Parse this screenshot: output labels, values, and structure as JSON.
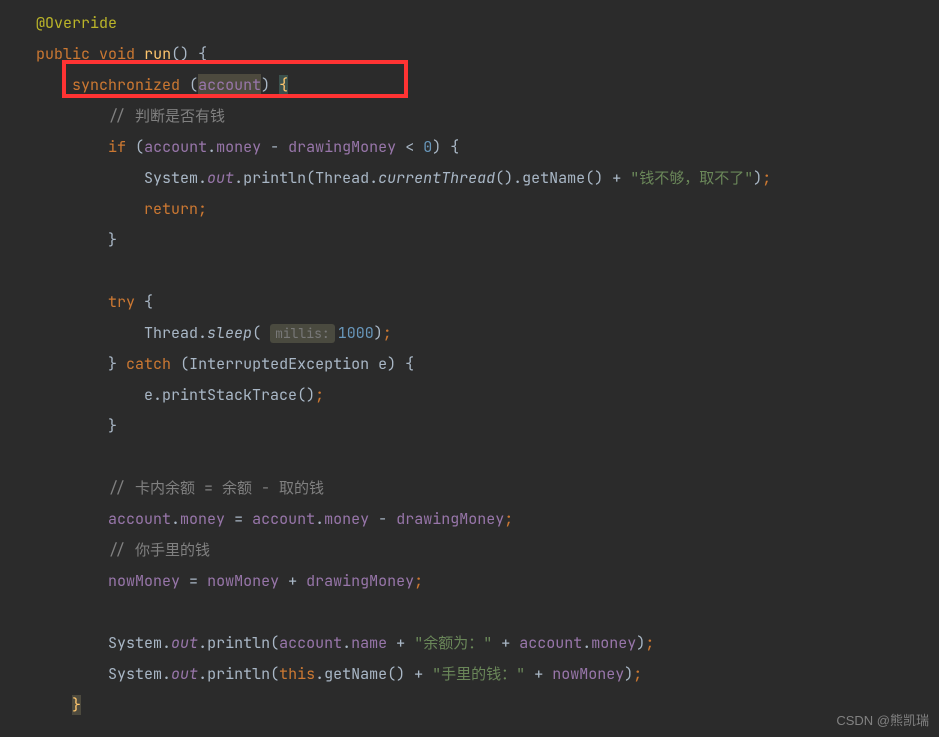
{
  "code": {
    "l1_annotation": "@Override",
    "l2_kw1": "public",
    "l2_kw2": "void",
    "l2_method": "run",
    "l3_kw": "synchronized",
    "l3_var": "account",
    "l4_comment": "// 判断是否有钱",
    "l5_kw": "if",
    "l5_acc": "account",
    "l5_money": "money",
    "l5_draw": "drawingMoney",
    "l5_zero": "0",
    "l6_sys": "System",
    "l6_out": "out",
    "l6_println": "println",
    "l6_thread": "Thread",
    "l6_ct": "currentThread",
    "l6_getName": "getName",
    "l6_str": "\"钱不够，取不了\"",
    "l7_kw": "return",
    "l9_kw": "try",
    "l10_thread": "Thread",
    "l10_sleep": "sleep",
    "l10_hint": "millis:",
    "l10_val": "1000",
    "l11_kw": "catch",
    "l11_exc": "InterruptedException",
    "l11_e": "e",
    "l12_e": "e",
    "l12_method": "printStackTrace",
    "l14_comment": "// 卡内余额 = 余额 - 取的钱",
    "l15_acc": "account",
    "l15_money": "money",
    "l15_draw": "drawingMoney",
    "l16_comment": "// 你手里的钱",
    "l17_now": "nowMoney",
    "l17_draw": "drawingMoney",
    "l18_sys": "System",
    "l18_out": "out",
    "l18_println": "println",
    "l18_acc": "account",
    "l18_name": "name",
    "l18_str": "\"余额为：\"",
    "l18_money": "money",
    "l19_sys": "System",
    "l19_out": "out",
    "l19_println": "println",
    "l19_kw": "this",
    "l19_getName": "getName",
    "l19_str": "\"手里的钱：\"",
    "l19_now": "nowMoney"
  },
  "watermark": "CSDN @熊凯瑞"
}
